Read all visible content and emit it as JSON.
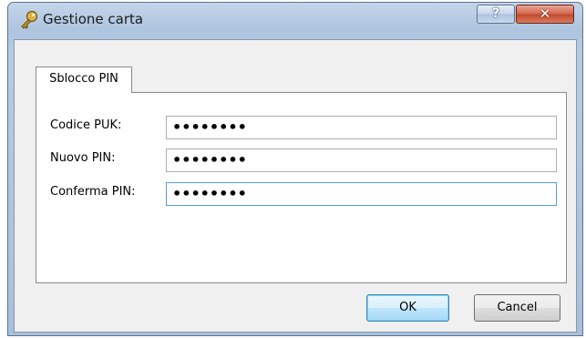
{
  "window": {
    "title": "Gestione carta",
    "icon": "key-icon",
    "help_label": "?",
    "close_label": "✕"
  },
  "tabs": [
    {
      "label": "Sblocco PIN",
      "selected": true
    }
  ],
  "form": {
    "puk_label": "Codice PUK:",
    "puk_value": "••••••••",
    "new_pin_label": "Nuovo PIN:",
    "new_pin_value": "••••••••",
    "confirm_pin_label": "Conferma PIN:",
    "confirm_pin_value": "••••••••"
  },
  "buttons": {
    "ok_label": "OK",
    "cancel_label": "Cancel"
  },
  "colors": {
    "focus_border": "#5b9bd5",
    "default_button": "#3c7fb1",
    "close_button": "#c3472b"
  }
}
